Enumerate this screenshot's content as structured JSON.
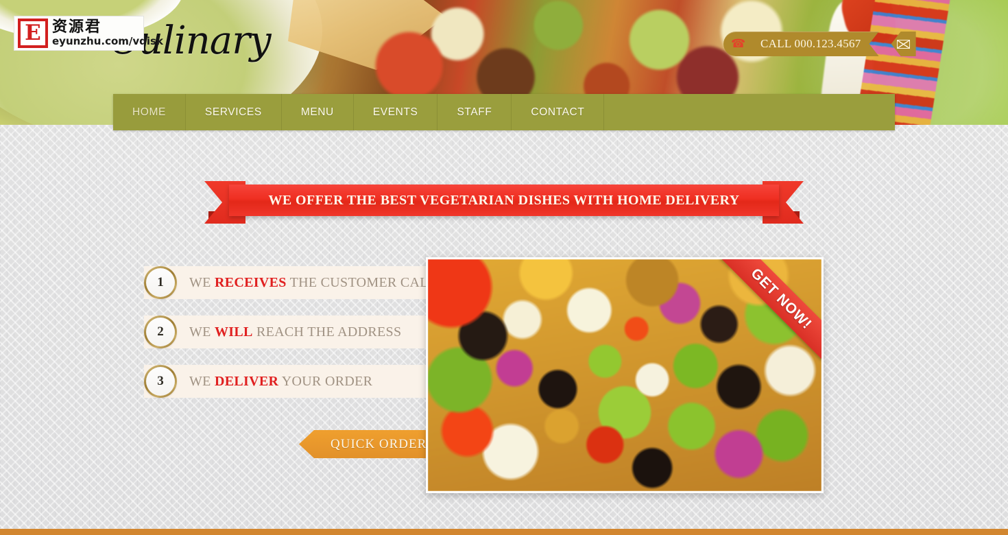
{
  "site": {
    "logo_text": "Culinary",
    "accent_olive": "#9a9e3d",
    "accent_red": "#ef2f22",
    "accent_orange": "#e2912a",
    "accent_gold": "#b08a2c"
  },
  "watermark": {
    "badge_letter": "E",
    "cn_text": "资源君",
    "url_text": "eyunzhu.com/vdisk"
  },
  "contact": {
    "phone_icon": "phone-icon",
    "call_label": "CALL 000.123.4567",
    "mail_icon": "envelope-icon"
  },
  "nav": {
    "items": [
      {
        "label": "HOME",
        "active": true
      },
      {
        "label": "SERVICES",
        "active": false
      },
      {
        "label": "MENU",
        "active": false
      },
      {
        "label": "EVENTS",
        "active": false
      },
      {
        "label": "STAFF",
        "active": false
      },
      {
        "label": "CONTACT",
        "active": false
      }
    ]
  },
  "headline": {
    "ribbon_text": "WE OFFER THE BEST VEGETARIAN DISHES WITH HOME DELIVERY"
  },
  "steps": [
    {
      "number": "1",
      "before": "WE ",
      "keyword": "RECEIVES",
      "after": " THE CUSTOMER CALL"
    },
    {
      "number": "2",
      "before": "WE ",
      "keyword": "WILL",
      "after": " REACH THE ADDRESS"
    },
    {
      "number": "3",
      "before": "WE ",
      "keyword": "DELIVER",
      "after": " YOUR ORDER"
    }
  ],
  "cta": {
    "quick_order_label": "QUICK ORDER",
    "corner_ribbon_label": "GET NOW!"
  },
  "feature_image": {
    "alt": "vegetarian-salad-photo"
  }
}
